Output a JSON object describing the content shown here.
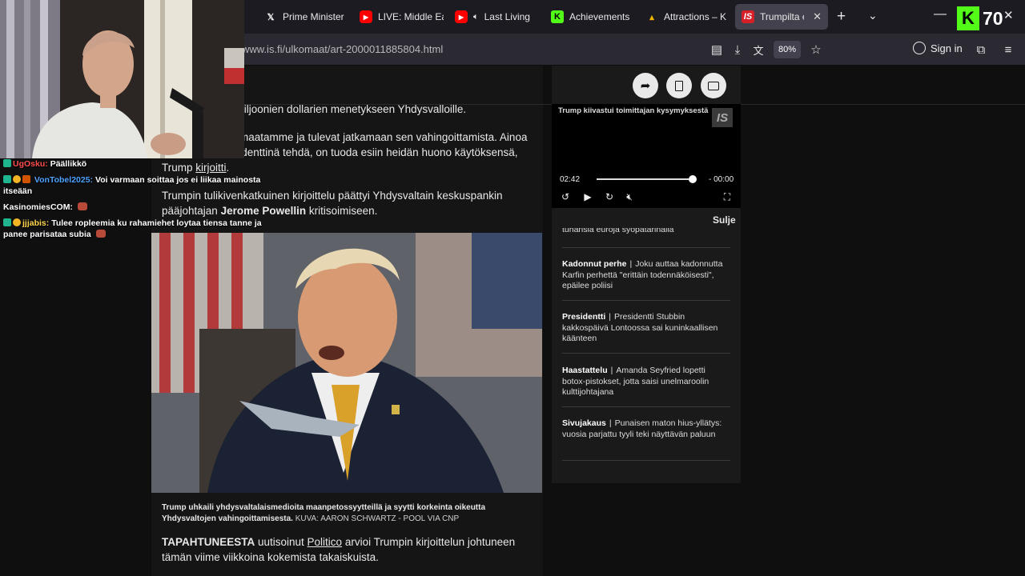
{
  "tabs": [
    {
      "icon": "x-icon",
      "label": "Prime Minister"
    },
    {
      "icon": "youtube-icon",
      "label": "LIVE: Middle Ea"
    },
    {
      "icon": "youtube-icon",
      "label": "Last Living"
    },
    {
      "icon": "kick-icon",
      "label": "Achievements"
    },
    {
      "icon": "attractions-icon",
      "label": "Attractions – K"
    },
    {
      "icon": "is-icon",
      "label": "Trumpilta en"
    }
  ],
  "active_tab_index": 5,
  "url": "www.is.fi/ulkomaat/art-2000011885804.html",
  "zoom": "80%",
  "sign_in": "Sign in",
  "article": {
    "p1": "a biljoonien dollarien menetykseen Yhdysvalloille.",
    "p2": "at maatamme ja tulevat jatkamaan sen vahingoittamista. Ainoa",
    "p2b": "esidenttinä tehdä, on tuoda esiin heidän huono käytöksensä,",
    "p3_prefix": "Trump ",
    "p3_link": "kirjoitti",
    "p3_suffix": ".",
    "p4_start": "Trumpin tulikivenkatkuinen kirjoittelu päättyi Yhdysvaltain keskuspankin pääjohtajan ",
    "p4_bold": "Jerome Powellin",
    "p4_end": " kritisoimiseen.",
    "caption": "Trump uhkaili yhdysvaltalaismedioita maanpetossyytteillä ja syytti korkeinta oikeutta Yhdysvaltojen vahingoittamisesta.",
    "caption_credit": "KUVA: AARON SCHWARTZ - POOL VIA CNP",
    "p5_bold": "TAPAHTUNEESTA",
    "p5_mid": " uutisoinut ",
    "p5_link": "Politico",
    "p5_end": " arvioi Trumpin kirjoittelun johtuneen tämän viime viikkoina kokemista takaiskuista."
  },
  "video": {
    "title": "Trump kiivastui toimittajan kysymyksestä",
    "logo": "IS",
    "time_current": "02:42",
    "time_remaining": "- 00:00",
    "progress": 1.0,
    "close_label": "Sulje"
  },
  "news_cut": "tuhansia euroja syöpätarinalla",
  "news": [
    {
      "category": "Kadonnut perhe",
      "text": "Joku auttaa kadonnutta Karfin perhettä \"erittäin todennäköisesti\", epäilee poliisi"
    },
    {
      "category": "Presidentti",
      "text": "Presidentti Stubbin kakkospäivä Lontoossa sai kuninkaallisen käänteen"
    },
    {
      "category": "Haastattelu",
      "text": "Amanda Seyfried lopetti botox-pistokset, jotta saisi unelmaroolin kulttijohtajana"
    },
    {
      "category": "Sivujakaus",
      "text": "Punaisen maton hius-yllätys: vuosia parjattu tyyli teki näyttävän paluun"
    }
  ],
  "chat": [
    {
      "user": "UgOsku:",
      "user_color": "#ff4d4d",
      "message": "Päällikkö"
    },
    {
      "user": "VonTobel2025:",
      "user_color": "#4da3ff",
      "message": "Voi varmaan soittaa jos ei liikaa mainosta itseään"
    },
    {
      "user": "KasinomiesCOM:",
      "user_color": "#ffffff",
      "message": ""
    },
    {
      "user": "jjjabis:",
      "user_color": "#ffd54d",
      "message": "Tulee ropleemia ku rahamiehet loytaa tiensa tanne ja panee parisataa subia"
    }
  ],
  "kick_viewers": "70"
}
